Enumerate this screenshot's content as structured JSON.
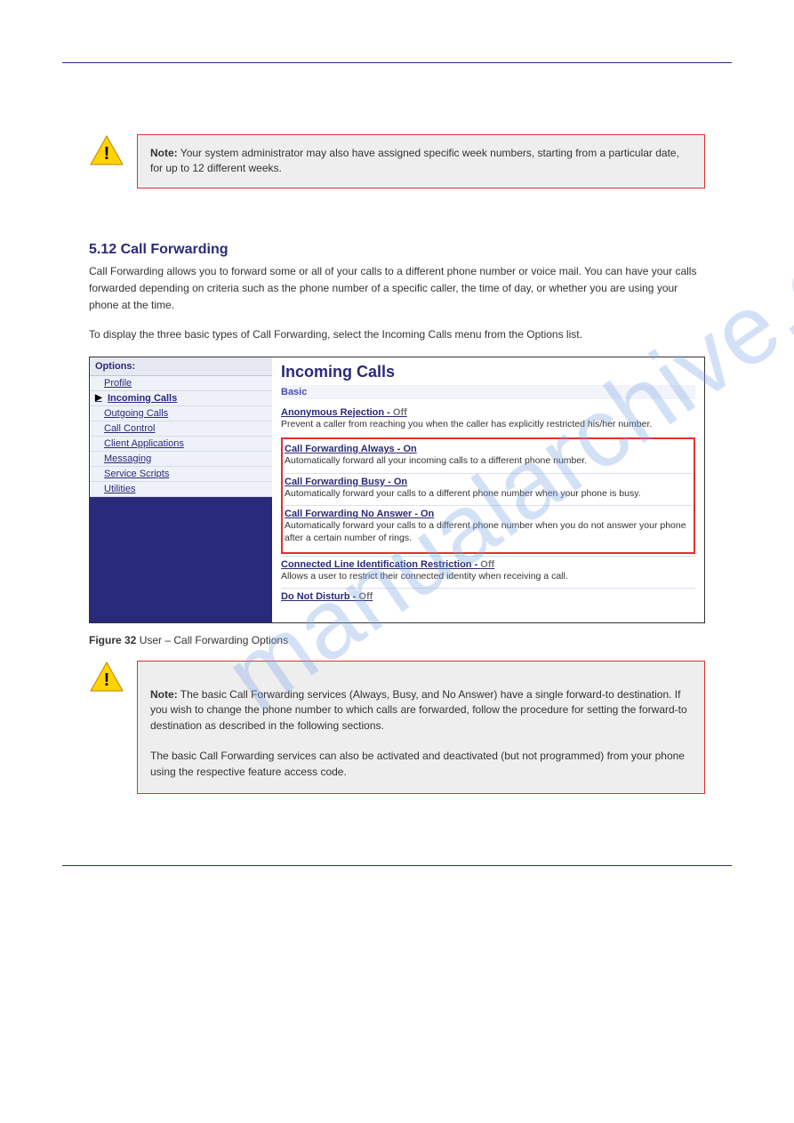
{
  "watermark": "manualarchive.com",
  "warning1": {
    "prefix": "Note:",
    "text": " Your system administrator may also have assigned specific week numbers, starting from a particular date, for up to 12 different weeks."
  },
  "section": {
    "title": "5.12 Call Forwarding",
    "p1": "Call Forwarding allows you to forward some or all of your calls to a different phone number or voice mail. You can have your calls forwarded depending on criteria such as the phone number of a specific caller, the time of day, or whether you are using your phone at the time.",
    "p2": "To display the three basic types of Call Forwarding, select the Incoming Calls menu from the Options list."
  },
  "caption1": {
    "num": "Figure 32",
    "text": " User – Call Forwarding Options"
  },
  "screenshot": {
    "sidebar": {
      "header": "Options:",
      "items": [
        {
          "label": "Profile",
          "selected": false
        },
        {
          "label": "Incoming Calls",
          "selected": true
        },
        {
          "label": "Outgoing Calls",
          "selected": false
        },
        {
          "label": "Call Control",
          "selected": false
        },
        {
          "label": "Client Applications",
          "selected": false
        },
        {
          "label": "Messaging",
          "selected": false
        },
        {
          "label": "Service Scripts",
          "selected": false
        },
        {
          "label": "Utilities",
          "selected": false
        }
      ]
    },
    "main": {
      "title": "Incoming Calls",
      "subhead": "Basic",
      "features": [
        {
          "title": "Anonymous Rejection",
          "status": "Off",
          "statusClass": "off",
          "desc": "Prevent a caller from reaching you when the caller has explicitly restricted his/her number.",
          "hl": false
        },
        {
          "title": "Call Forwarding Always",
          "status": "On",
          "statusClass": "on",
          "desc": "Automatically forward all your incoming calls to a different phone number.",
          "hl": true
        },
        {
          "title": "Call Forwarding Busy",
          "status": "On",
          "statusClass": "on",
          "desc": "Automatically forward your calls to a different phone number when your phone is busy.",
          "hl": true
        },
        {
          "title": "Call Forwarding No Answer",
          "status": "On",
          "statusClass": "on",
          "desc": "Automatically forward your calls to a different phone number when you do not answer your phone after a certain number of rings.",
          "hl": true
        },
        {
          "title": "Connected Line Identification Restriction",
          "status": "Off",
          "statusClass": "off",
          "desc": "Allows a user to restrict their connected identity when receiving a call.",
          "hl": false
        },
        {
          "title": "Do Not Disturb",
          "status": "Off",
          "statusClass": "off",
          "desc": "",
          "hl": false
        }
      ]
    }
  },
  "warning2": {
    "prefix": "Note:",
    "text": " The basic Call Forwarding services (Always, Busy, and No Answer) have a single forward-to destination. If you wish to change the phone number to which calls are forwarded, follow the procedure for setting the forward-to destination as described in the following sections.\n\nThe basic Call Forwarding services can also be activated and deactivated (but not programmed) from your phone using the respective feature access code."
  }
}
